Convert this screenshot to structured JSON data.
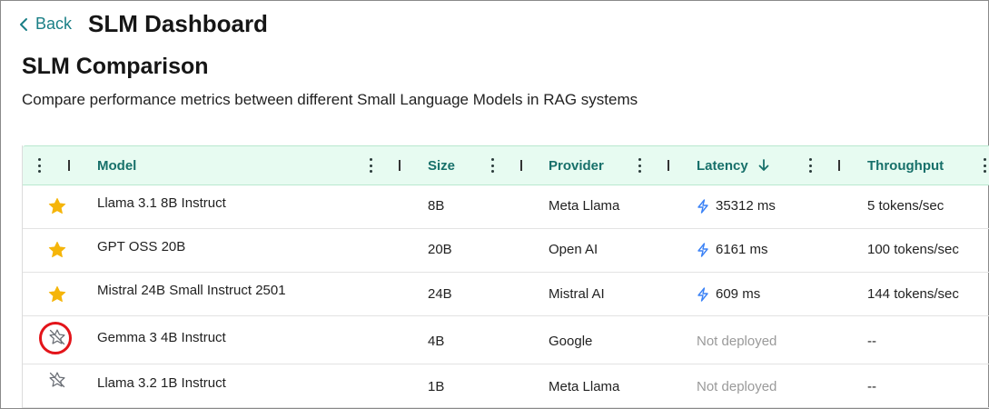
{
  "header": {
    "back_label": "Back",
    "app_title": "SLM Dashboard"
  },
  "page": {
    "title": "SLM Comparison",
    "subtitle": "Compare performance metrics between different Small Language Models in RAG systems"
  },
  "table": {
    "columns": {
      "model": "Model",
      "size": "Size",
      "provider": "Provider",
      "latency": "Latency",
      "throughput": "Throughput"
    },
    "sort": {
      "column": "latency",
      "direction": "descending"
    },
    "rows": [
      {
        "favorite": true,
        "model": "Llama 3.1 8B Instruct",
        "size": "8B",
        "provider": "Meta Llama",
        "latency": "35312 ms",
        "latency_deployed": true,
        "throughput": "5 tokens/sec"
      },
      {
        "favorite": true,
        "model": "GPT OSS 20B",
        "size": "20B",
        "provider": "Open AI",
        "latency": "6161 ms",
        "latency_deployed": true,
        "throughput": "100 tokens/sec"
      },
      {
        "favorite": true,
        "model": "Mistral 24B Small Instruct 2501",
        "size": "24B",
        "provider": "Mistral AI",
        "latency": "609 ms",
        "latency_deployed": true,
        "throughput": "144 tokens/sec"
      },
      {
        "favorite": false,
        "model": "Gemma 3 4B Instruct",
        "size": "4B",
        "provider": "Google",
        "latency": "Not deployed",
        "latency_deployed": false,
        "throughput": "--",
        "highlighted": true
      },
      {
        "favorite": false,
        "model": "Llama 3.2 1B Instruct",
        "size": "1B",
        "provider": "Meta Llama",
        "latency": "Not deployed",
        "latency_deployed": false,
        "throughput": "--"
      }
    ]
  },
  "colors": {
    "accent": "#1a7f86",
    "header_bg": "#e7fbf1",
    "star": "#f5b50a",
    "lightning": "#3b82f6",
    "highlight": "#e3141a"
  },
  "icons": {
    "back": "chevron-left-icon",
    "favorite_on": "star-filled-icon",
    "favorite_off": "star-off-icon",
    "latency": "lightning-icon",
    "sort": "arrow-down-icon",
    "menu": "kebab-menu-icon"
  }
}
